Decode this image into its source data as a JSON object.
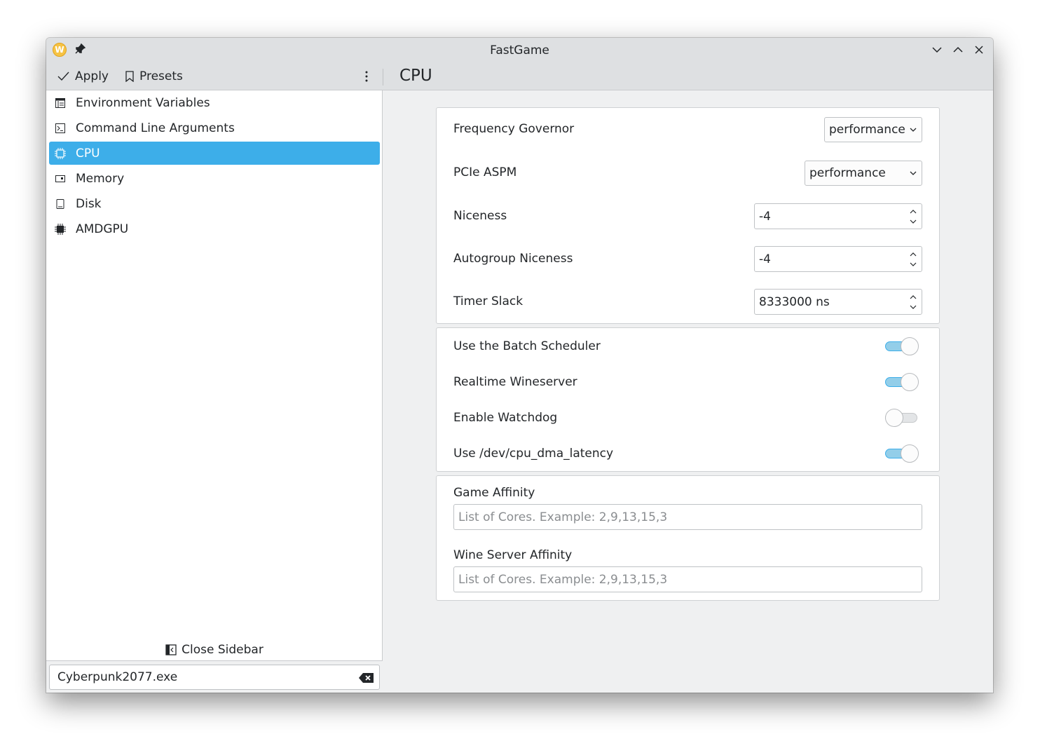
{
  "window": {
    "title": "FastGame",
    "app_icon": "W"
  },
  "toolbar": {
    "apply_label": "Apply",
    "presets_label": "Presets",
    "page_title": "CPU"
  },
  "sidebar": {
    "items": [
      {
        "label": "Environment Variables",
        "icon": "table-icon"
      },
      {
        "label": "Command Line Arguments",
        "icon": "terminal-icon"
      },
      {
        "label": "CPU",
        "icon": "chip-icon",
        "active": true
      },
      {
        "label": "Memory",
        "icon": "memory-icon"
      },
      {
        "label": "Disk",
        "icon": "disk-icon"
      },
      {
        "label": "AMDGPU",
        "icon": "gpu-chip-icon"
      }
    ],
    "close_label": "Close Sidebar",
    "executable": "Cyberpunk2077.exe"
  },
  "cpu": {
    "frequency_governor": {
      "label": "Frequency Governor",
      "value": "performance"
    },
    "pcie_aspm": {
      "label": "PCIe ASPM",
      "value": "performance"
    },
    "niceness": {
      "label": "Niceness",
      "value": "-4"
    },
    "autogroup_niceness": {
      "label": "Autogroup Niceness",
      "value": "-4"
    },
    "timer_slack": {
      "label": "Timer Slack",
      "value": "8333000 ns"
    },
    "toggles": [
      {
        "label": "Use the Batch Scheduler",
        "on": true
      },
      {
        "label": "Realtime Wineserver",
        "on": true
      },
      {
        "label": "Enable Watchdog",
        "on": false
      },
      {
        "label": "Use /dev/cpu_dma_latency",
        "on": true
      }
    ],
    "game_affinity": {
      "label": "Game Affinity",
      "placeholder": "List of Cores. Example: 2,9,13,15,3"
    },
    "wine_server_affinity": {
      "label": "Wine Server Affinity",
      "placeholder": "List of Cores. Example: 2,9,13,15,3"
    }
  },
  "colors": {
    "accent": "#3daee9",
    "background": "#eff0f1",
    "titlebar": "#dee0e2"
  }
}
